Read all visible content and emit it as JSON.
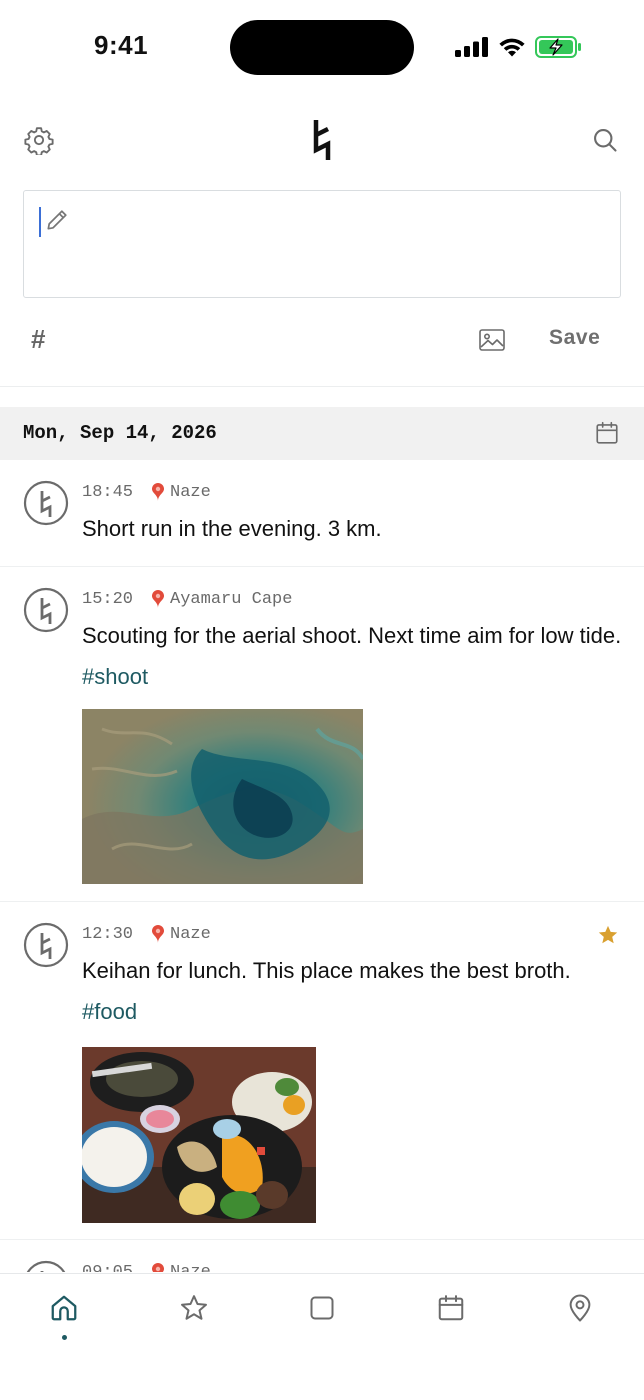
{
  "status_bar": {
    "time": "9:41",
    "icons": [
      "signal-icon",
      "wifi-icon",
      "battery-charging-icon"
    ],
    "battery_color": "#34c759"
  },
  "header": {
    "icons": [
      "settings-icon",
      "app-logo",
      "search-icon"
    ]
  },
  "composer": {
    "placeholder": "",
    "value": "",
    "tag_button_label": "#",
    "save_label": "Save"
  },
  "date_header": {
    "label": "Mon, Sep 14, 2026"
  },
  "entries": [
    {
      "time": "18:45",
      "location": "Naze",
      "text": "Short run in the evening. 3 km.",
      "tag": "",
      "starred": false,
      "has_photo": false
    },
    {
      "time": "15:20",
      "location": "Ayamaru Cape",
      "text": "Scouting for the aerial shoot. Next time aim for low tide.",
      "tag": "#shoot",
      "starred": false,
      "has_photo": true,
      "photo": "aerial-reef-photo"
    },
    {
      "time": "12:30",
      "location": "Naze",
      "text": "Keihan for lunch. This place makes the best broth.",
      "tag": "#food",
      "starred": true,
      "has_photo": true,
      "photo": "keihan-lunch-photo"
    },
    {
      "time": "09:05",
      "location": "Naze",
      "text": "",
      "tag": "",
      "starred": false,
      "has_photo": false
    }
  ],
  "tab_bar": {
    "tabs": [
      "home-icon",
      "star-icon",
      "square-icon",
      "calendar-icon",
      "map-pin-icon"
    ],
    "active": "home-icon"
  },
  "colors": {
    "accent": "#1e5a62",
    "star": "#d9a030",
    "pin": "#e24b3b",
    "cursor": "#3b6fd6"
  }
}
